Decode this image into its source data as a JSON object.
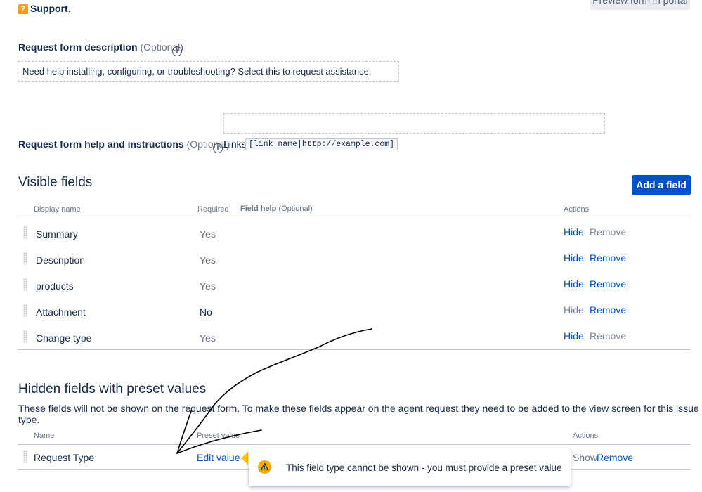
{
  "header": {
    "support_label": "Support",
    "support_period": ".",
    "support_icon": "question-icon",
    "preview_button": "Preview form in portal"
  },
  "description": {
    "label": "Request form description",
    "optional": "(Optional)",
    "value": "Need help installing, configuring, or troubleshooting? Select this to request assistance."
  },
  "help": {
    "label": "Request form help and instructions",
    "optional": "(Optional)",
    "links_label": "Links",
    "links_syntax": "[link name|http://example.com]"
  },
  "visible_fields": {
    "title": "Visible fields",
    "add_button": "Add a field",
    "headers": {
      "display_name": "Display name",
      "required": "Required",
      "field_help": "Field help",
      "field_help_optional": "(Optional)",
      "actions": "Actions"
    },
    "rows": [
      {
        "name": "Summary",
        "required": "Yes",
        "hide": "Hide",
        "remove": "Remove",
        "hide_enabled": true,
        "remove_enabled": false
      },
      {
        "name": "Description",
        "required": "Yes",
        "hide": "Hide",
        "remove": "Remove",
        "hide_enabled": true,
        "remove_enabled": true
      },
      {
        "name": "products",
        "required": "Yes",
        "hide": "Hide",
        "remove": "Remove",
        "hide_enabled": true,
        "remove_enabled": true
      },
      {
        "name": "Attachment",
        "required": "No",
        "hide": "Hide",
        "remove": "Remove",
        "hide_enabled": false,
        "remove_enabled": true
      },
      {
        "name": "Change type",
        "required": "Yes",
        "hide": "Hide",
        "remove": "Remove",
        "hide_enabled": true,
        "remove_enabled": false
      }
    ]
  },
  "hidden_fields": {
    "title": "Hidden fields with preset values",
    "description": "These fields will not be shown on the request form. To make these fields appear on the agent request they need to be added to the view screen for this issue type.",
    "headers": {
      "name": "Name",
      "preset_value": "Preset value",
      "actions": "Actions"
    },
    "rows": [
      {
        "name": "Request Type",
        "preset": "Edit value",
        "show": "Show",
        "remove": "Remove"
      }
    ]
  },
  "tooltip": {
    "icon": "warning-icon",
    "text": "This field type cannot be shown - you must provide a preset value"
  },
  "colors": {
    "primary": "#0052cc",
    "text": "#172b4d",
    "muted": "#6b778c",
    "warning": "#ffab00",
    "support_icon": "#ff991f"
  }
}
